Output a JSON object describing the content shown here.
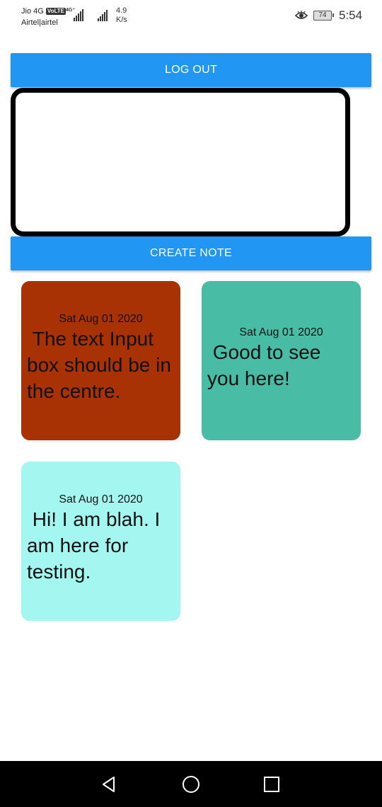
{
  "status_bar": {
    "carrier_1": "Jio 4G",
    "volte": "VoLTE",
    "net_type": "4G⁺",
    "carrier_2": "Airtel|airtel",
    "speed_value": "4.9",
    "speed_unit": "K/s",
    "battery": "74",
    "time": "5:54"
  },
  "logout_label": "LOG OUT",
  "note_input": {
    "value": ""
  },
  "create_label": "CREATE NOTE",
  "notes": [
    {
      "date": "Sat Aug 01 2020",
      "text": " The text Input box should be in the centre.",
      "color": "#a83204"
    },
    {
      "date": "Sat Aug 01 2020",
      "text": " Good to see you here!",
      "color": "#48bca5"
    },
    {
      "date": "Sat Aug 01 2020",
      "text": " Hi! I am blah. I am here for testing.",
      "color": "#a3f7f0"
    }
  ],
  "icons": {
    "eye": "eye-icon",
    "back": "back-triangle-icon",
    "home": "home-circle-icon",
    "recents": "recents-square-icon"
  }
}
